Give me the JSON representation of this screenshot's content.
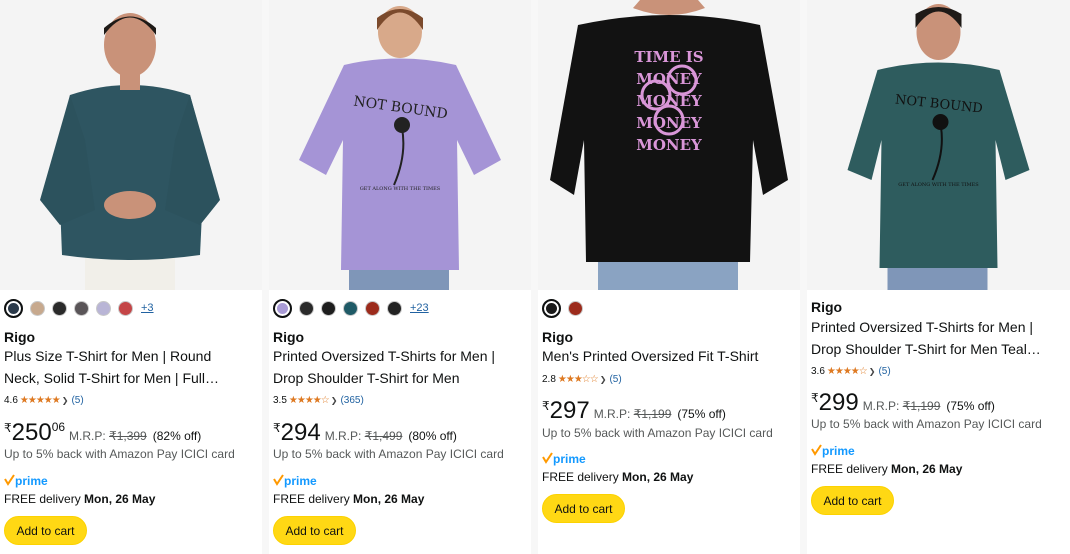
{
  "colors": {
    "star": "#de7921",
    "button": "#ffd814",
    "link": "#2162a1",
    "prime": "#1399ff"
  },
  "products": [
    {
      "swatches": [
        "#2b3a4a",
        "#c7a98e",
        "#2a2a2a",
        "#5a5558",
        "#b9b5d6",
        "#c44547"
      ],
      "more": "+3",
      "brand": "Rigo",
      "title_l1": "Plus Size T-Shirt for Men | Round",
      "title_l2": "Neck, Solid T-Shirt for Men | Full…",
      "rating": "4.6",
      "stars": "★★★★★",
      "reviews": "(5)",
      "currency": "₹",
      "price_whole": "250",
      "price_frac": "06",
      "mrp_label": "M.R.P:",
      "mrp": "₹1,399",
      "off": "(82% off)",
      "cashback": "Up to 5% back with Amazon Pay ICICI card",
      "prime": "prime",
      "delivery_prefix": "FREE delivery",
      "delivery_date": "Mon, 26 May",
      "button": "Add to cart"
    },
    {
      "swatches": [
        "#a99bd6",
        "#2a2a2a",
        "#1e1e1e",
        "#1f5a66",
        "#9c2b1c",
        "#222222"
      ],
      "more": "+23",
      "brand": "Rigo",
      "title_l1": "Printed Oversized T-Shirts for Men |",
      "title_l2": "Drop Shoulder T-Shirt for Men",
      "rating": "3.5",
      "stars": "★★★★☆",
      "reviews": "(365)",
      "currency": "₹",
      "price_whole": "294",
      "price_frac": "",
      "mrp_label": "M.R.P:",
      "mrp": "₹1,499",
      "off": "(80% off)",
      "cashback": "Up to 5% back with Amazon Pay ICICI card",
      "prime": "prime",
      "delivery_prefix": "FREE delivery",
      "delivery_date": "Mon, 26 May",
      "button": "Add to cart"
    },
    {
      "swatches": [
        "#1a1a1a",
        "#9c2b1c"
      ],
      "more": "",
      "brand": "Rigo",
      "title_l1": "Men's Printed Oversized Fit T-Shirt",
      "title_l2": "",
      "rating": "2.8",
      "stars": "★★★☆☆",
      "reviews": "(5)",
      "currency": "₹",
      "price_whole": "297",
      "price_frac": "",
      "mrp_label": "M.R.P:",
      "mrp": "₹1,199",
      "off": "(75% off)",
      "cashback": "Up to 5% back with Amazon Pay ICICI card",
      "prime": "prime",
      "delivery_prefix": "FREE delivery",
      "delivery_date": "Mon, 26 May",
      "button": "Add to cart"
    },
    {
      "swatches": [],
      "more": "",
      "brand": "Rigo",
      "title_l1": "Printed Oversized T-Shirts for Men |",
      "title_l2": "Drop Shoulder T-Shirt for Men Teal…",
      "rating": "3.6",
      "stars": "★★★★☆",
      "reviews": "(5)",
      "currency": "₹",
      "price_whole": "299",
      "price_frac": "",
      "mrp_label": "M.R.P:",
      "mrp": "₹1,199",
      "off": "(75% off)",
      "cashback": "Up to 5% back with Amazon Pay ICICI card",
      "prime": "prime",
      "delivery_prefix": "FREE delivery",
      "delivery_date": "Mon, 26 May",
      "button": "Add to cart"
    }
  ]
}
